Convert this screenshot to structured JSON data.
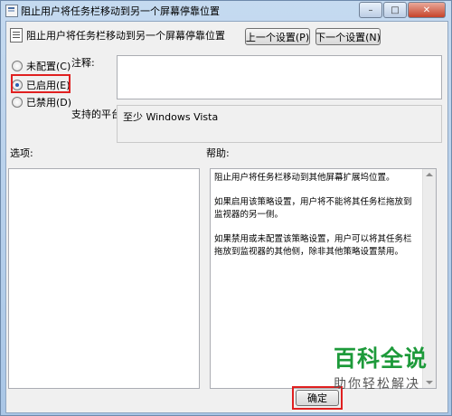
{
  "window": {
    "title": "阻止用户将任务栏移动到另一个屏幕停靠位置",
    "controls": {
      "minimize": "–",
      "maximize": "□",
      "close": "✕"
    }
  },
  "header": {
    "title": "阻止用户将任务栏移动到另一个屏幕停靠位置",
    "prev_button": "上一个设置(P)",
    "next_button": "下一个设置(N)"
  },
  "state": {
    "options": [
      {
        "label": "未配置(C)",
        "checked": false
      },
      {
        "label": "已启用(E)",
        "checked": true
      },
      {
        "label": "已禁用(D)",
        "checked": false
      }
    ]
  },
  "comment_label": "注释:",
  "comment_value": "",
  "platform_label": "支持的平台:",
  "platform_value": "至少 Windows Vista",
  "options_label": "选项:",
  "help_label": "帮助:",
  "help_paragraphs": [
    "阻止用户将任务栏移动到其他屏幕扩展坞位置。",
    "如果启用该策略设置，用户将不能将其任务栏拖放到监视器的另一侧。",
    "如果禁用或未配置该策略设置，用户可以将其任务栏拖放到监视器的其他侧，除非其他策略设置禁用。"
  ],
  "footer": {
    "ok_button": "确定"
  },
  "watermark": {
    "main": "百科全说",
    "sub": "助你轻松解决"
  },
  "colors": {
    "highlight": "#e02020",
    "watermark": "#1d9a3a",
    "radio_selected": "#2a5db0"
  },
  "icons": {
    "title": "policy-icon",
    "header": "document-icon"
  }
}
